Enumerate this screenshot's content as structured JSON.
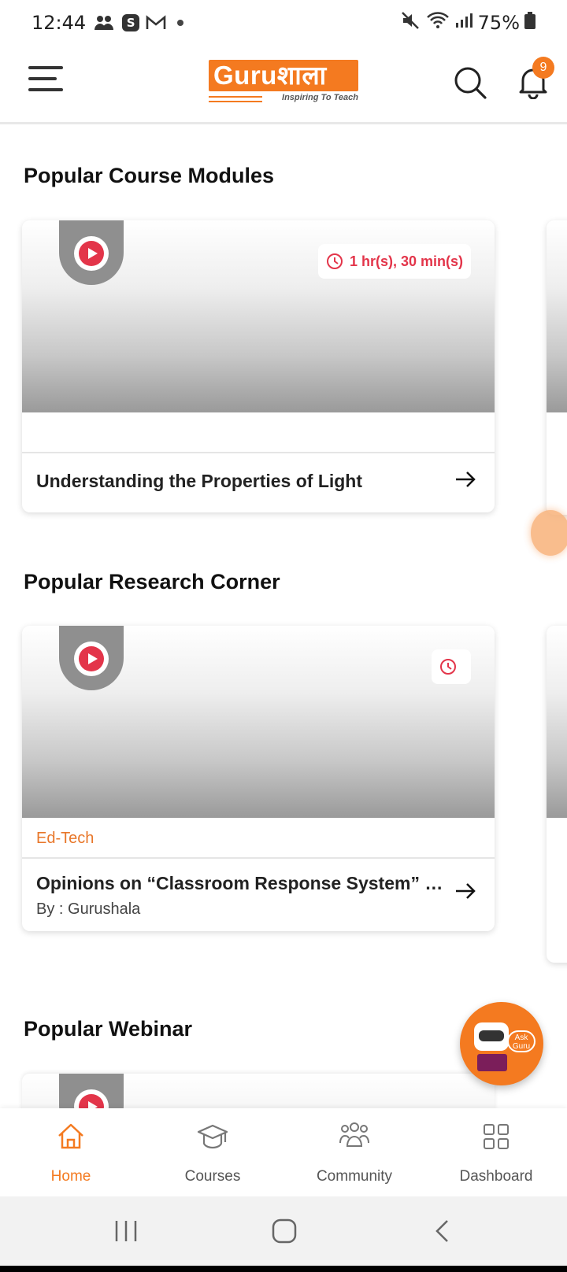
{
  "status_bar": {
    "time": "12:44",
    "battery": "75%",
    "s_badge": "S"
  },
  "header": {
    "logo_text": "Guruशाला",
    "logo_tagline": "Inspiring To Teach",
    "notification_count": "9"
  },
  "sections": [
    {
      "title": "Popular Course Modules",
      "card": {
        "duration": "1 hr(s), 30 min(s)",
        "category": "",
        "title": "Understanding the Properties of Light",
        "subtitle": ""
      }
    },
    {
      "title": "Popular Research Corner",
      "card": {
        "duration": "",
        "category": "Ed-Tech",
        "title": "Opinions on “Classroom Response System” by the Teachers",
        "subtitle": "By : Gurushala"
      }
    },
    {
      "title": "Popular Webinar"
    }
  ],
  "ask_guru": {
    "label_line1": "Ask",
    "label_line2": "Guru"
  },
  "bottom_nav": [
    {
      "label": "Home",
      "icon": "home-icon",
      "active": true
    },
    {
      "label": "Courses",
      "icon": "graduation-cap-icon",
      "active": false
    },
    {
      "label": "Community",
      "icon": "community-icon",
      "active": false
    },
    {
      "label": "Dashboard",
      "icon": "dashboard-icon",
      "active": false
    }
  ],
  "colors": {
    "brand_orange": "#f47a20",
    "play_red": "#e3354a"
  }
}
